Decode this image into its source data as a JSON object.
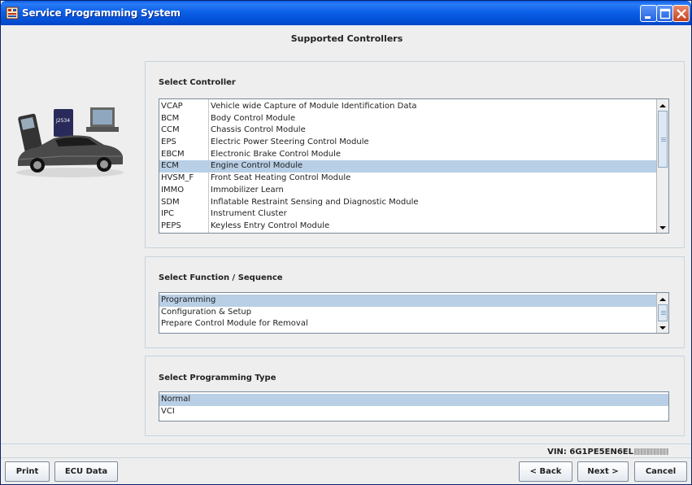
{
  "window": {
    "title": "Service Programming System"
  },
  "heading": "Supported Controllers",
  "controller_group": {
    "label": "Select Controller",
    "items": [
      {
        "code": "VCAP",
        "name": "Vehicle wide Capture of Module Identification Data",
        "selected": false
      },
      {
        "code": "BCM",
        "name": "Body Control Module",
        "selected": false
      },
      {
        "code": "CCM",
        "name": "Chassis Control Module",
        "selected": false
      },
      {
        "code": "EPS",
        "name": "Electric Power Steering Control Module",
        "selected": false
      },
      {
        "code": "EBCM",
        "name": "Electronic Brake Control Module",
        "selected": false
      },
      {
        "code": "ECM",
        "name": "Engine Control Module",
        "selected": true
      },
      {
        "code": "HVSM_F",
        "name": "Front Seat Heating Control Module",
        "selected": false
      },
      {
        "code": "IMMO",
        "name": "Immobilizer Learn",
        "selected": false
      },
      {
        "code": "SDM",
        "name": "Inflatable Restraint Sensing and Diagnostic Module",
        "selected": false
      },
      {
        "code": "IPC",
        "name": "Instrument Cluster",
        "selected": false
      },
      {
        "code": "PEPS",
        "name": "Keyless Entry Control Module",
        "selected": false
      }
    ]
  },
  "function_group": {
    "label": "Select Function / Sequence",
    "items": [
      {
        "label": "Programming",
        "selected": true
      },
      {
        "label": "Configuration & Setup",
        "selected": false
      },
      {
        "label": "Prepare Control Module for Removal",
        "selected": false
      }
    ]
  },
  "type_group": {
    "label": "Select Programming Type",
    "items": [
      {
        "label": "Normal",
        "selected": true
      },
      {
        "label": "VCI",
        "selected": false
      }
    ]
  },
  "vin": {
    "label": "VIN:",
    "value": "6G1PE5EN6EL"
  },
  "buttons": {
    "print": "Print",
    "ecu_data": "ECU Data",
    "back": "< Back",
    "next": "Next >",
    "cancel": "Cancel"
  },
  "car_art": {
    "device_label": "J2534"
  },
  "colors": {
    "titlebar": "#0450d6",
    "selection": "#b8cfe5",
    "background": "#eeeeee"
  }
}
